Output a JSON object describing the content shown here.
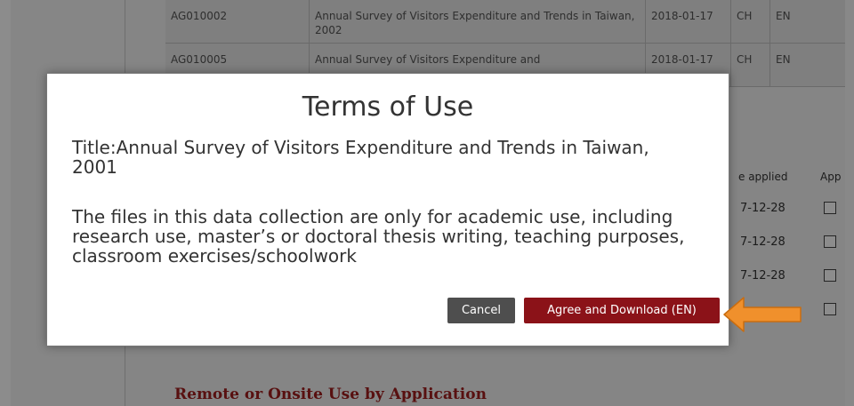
{
  "background": {
    "rows": [
      {
        "id": "AG010002",
        "title": "Annual Survey of Visitors Expenditure and Trends in Taiwan, 2002",
        "date": "2018-01-17",
        "lang1": "CH",
        "lang2": "EN"
      },
      {
        "id": "AG010005",
        "title": "Annual Survey of Visitors Expenditure and",
        "date": "2018-01-17",
        "lang1": "CH",
        "lang2": "EN"
      }
    ],
    "side_headers": {
      "col1": "e applied",
      "col2": "App"
    },
    "side_rows": [
      {
        "date": "7-12-28"
      },
      {
        "date": "7-12-28"
      },
      {
        "date": "7-12-28"
      },
      {
        "date": ""
      }
    ],
    "remote_link": "Remote or Onsite Use by Application"
  },
  "modal": {
    "title": "Terms of Use",
    "subtitle": "Title:Annual Survey of Visitors Expenditure and Trends in Taiwan, 2001",
    "body": "The files in this data collection are only for academic use, including research use, master’s or doctoral thesis writing, teaching purposes, classroom exercises/schoolwork",
    "cancel_label": "Cancel",
    "agree_label": "Agree and Download (EN)"
  },
  "colors": {
    "agree_button": "#8b1218",
    "cancel_button": "#4e4e4e",
    "arrow": "#f0902c",
    "link": "#a01e1e"
  },
  "icons": {
    "pointer": "arrow-left-icon"
  }
}
